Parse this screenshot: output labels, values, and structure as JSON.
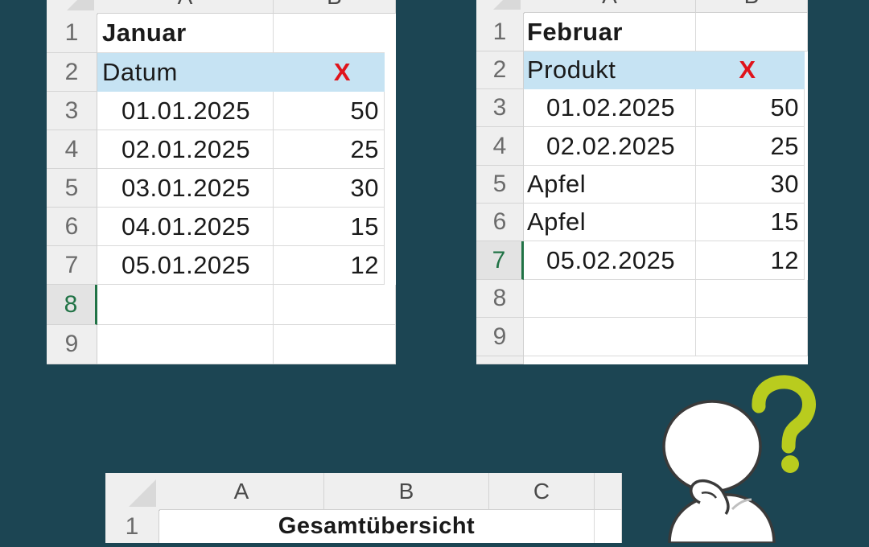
{
  "sheet_jan": {
    "col_a": "A",
    "col_b": "B",
    "rows": [
      "1",
      "2",
      "3",
      "4",
      "5",
      "6",
      "7",
      "8",
      "9"
    ],
    "title": "Januar",
    "header_a": "Datum",
    "header_b": "X",
    "data": [
      {
        "a": "01.01.2025",
        "b": "50"
      },
      {
        "a": "02.01.2025",
        "b": "25"
      },
      {
        "a": "03.01.2025",
        "b": "30"
      },
      {
        "a": "04.01.2025",
        "b": "15"
      },
      {
        "a": "05.01.2025",
        "b": "12"
      }
    ],
    "selected_row": "8"
  },
  "sheet_feb": {
    "col_a": "A",
    "col_b": "B",
    "rows": [
      "1",
      "2",
      "3",
      "4",
      "5",
      "6",
      "7",
      "8",
      "9"
    ],
    "title": "Februar",
    "header_a": "Produkt",
    "header_b": "X",
    "data": [
      {
        "a": "01.02.2025",
        "b": "50"
      },
      {
        "a": "02.02.2025",
        "b": "25"
      },
      {
        "a": "Apfel",
        "b": "30"
      },
      {
        "a": "Apfel",
        "b": "15"
      },
      {
        "a": "05.02.2025",
        "b": "12"
      }
    ],
    "selected_row": "7"
  },
  "sheet_total": {
    "col_a": "A",
    "col_b": "B",
    "col_c": "C",
    "row1": "1",
    "title": "Gesamtübersicht"
  },
  "colors": {
    "background": "#1c4553",
    "header_fill": "#c6e3f3",
    "x_mark": "#e0141c",
    "selection": "#217346",
    "question_mark": "#b9cc1e"
  },
  "illustration": "thinking-person-with-question-mark"
}
